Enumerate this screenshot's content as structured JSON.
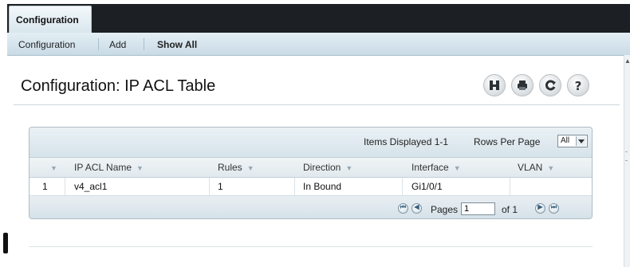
{
  "top_tab": {
    "label": "Configuration"
  },
  "subnav": {
    "items": [
      "Configuration",
      "Add",
      "Show All"
    ]
  },
  "page": {
    "title": "Configuration: IP ACL Table"
  },
  "toolbar": {
    "icons": [
      "save-icon",
      "print-icon",
      "refresh-icon",
      "help-icon"
    ]
  },
  "table": {
    "items_displayed": "Items Displayed 1-1",
    "rows_per_page_label": "Rows Per Page",
    "rows_per_page_value": "All",
    "columns": [
      "IP ACL Name",
      "Rules",
      "Direction",
      "Interface",
      "VLAN"
    ],
    "rows": [
      {
        "index": "1",
        "name": "v4_acl1",
        "rules": "1",
        "direction": "In Bound",
        "interface": "Gi1/0/1",
        "vlan": ""
      }
    ]
  },
  "pagination": {
    "pages_label": "Pages",
    "current_page": "1",
    "of_label": "of 1"
  },
  "colors": {
    "topbar": "#1c1f23",
    "subnav": "#d6e4ec",
    "grid": "#dfe9ef",
    "accent": "#36607c"
  }
}
